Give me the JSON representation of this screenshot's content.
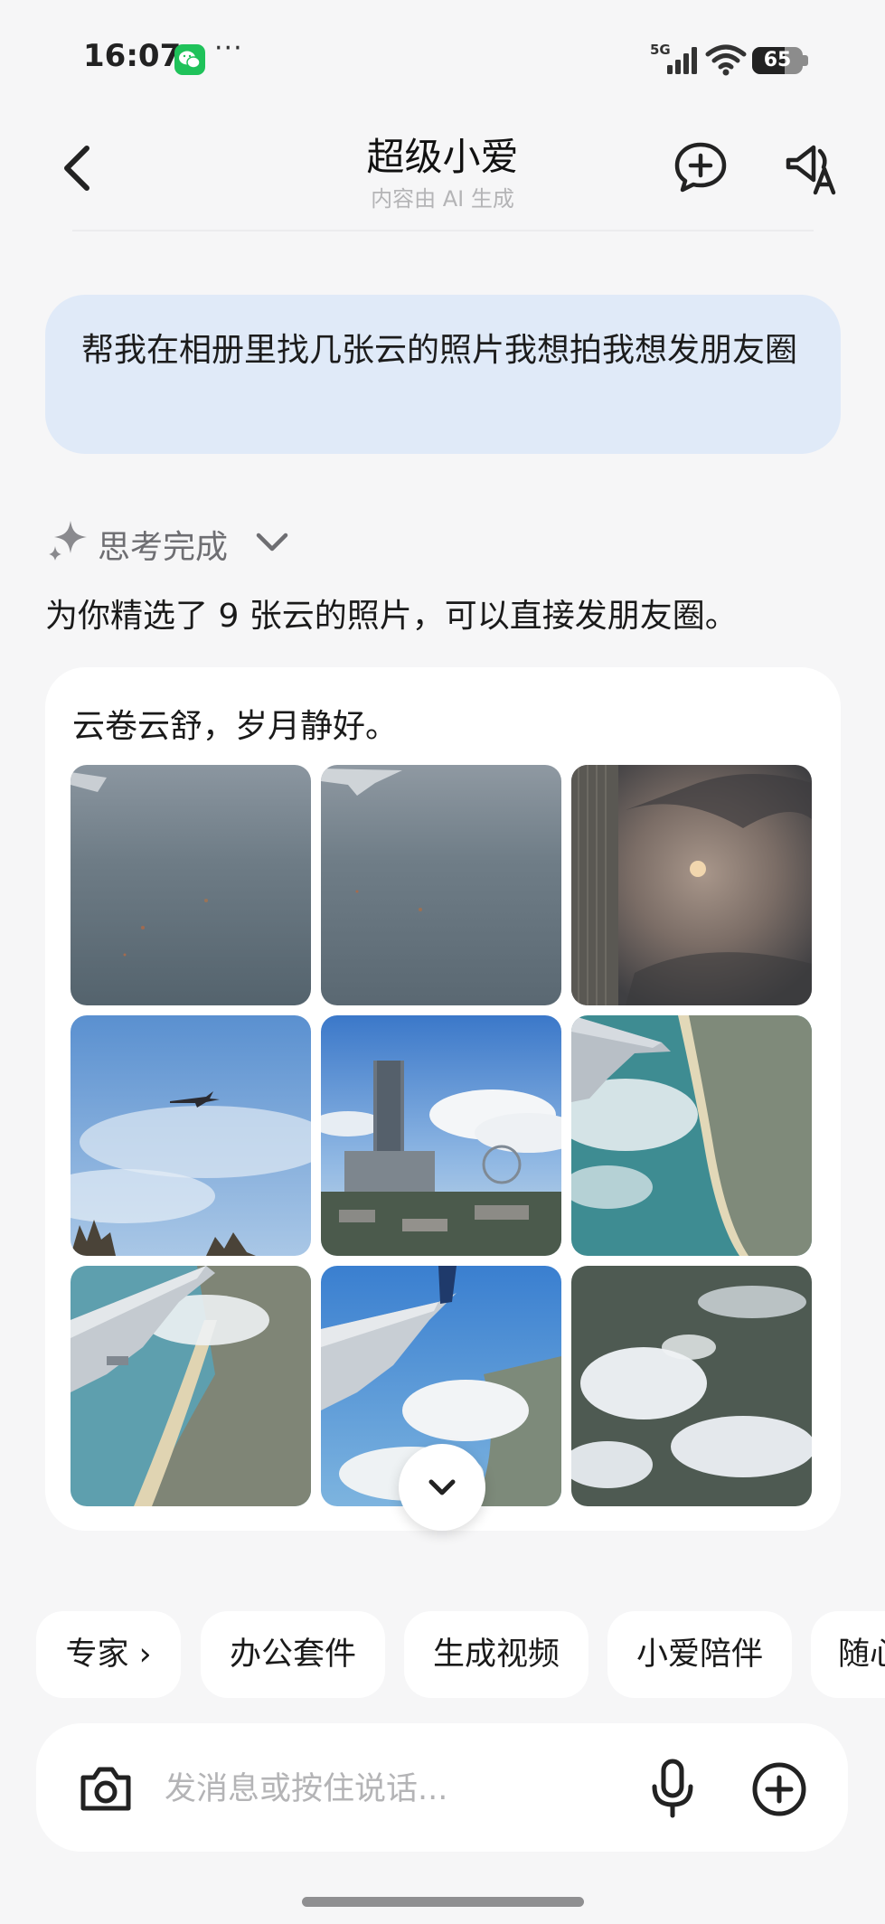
{
  "status_bar": {
    "time": "16:07",
    "dots": "···",
    "network": "5G",
    "battery": "65",
    "battery_level": 0.65
  },
  "header": {
    "title": "超级小爱",
    "subtitle": "内容由 AI 生成"
  },
  "chat": {
    "user_message": "帮我在相册里找几张云的照片我想拍我想发朋友圈",
    "thinking_status": "思考完成",
    "reply": "为你精选了 9 张云的照片，可以直接发朋友圈。",
    "caption": "云卷云舒，岁月静好。",
    "photos": [
      "airplane-window-haze",
      "airplane-wing-haze",
      "moon-behind-clouds",
      "airplane-in-blue-sky",
      "tower-building-clouds",
      "wing-over-coastline",
      "wing-over-sea",
      "wing-over-beach",
      "clouds-over-land"
    ]
  },
  "chips": [
    "专家 ›",
    "办公套件",
    "生成视频",
    "小爱陪伴",
    "随心"
  ],
  "input": {
    "placeholder": "发消息或按住说话..."
  },
  "colors": {
    "accent_bubble": "#e0eaf8",
    "background": "#f6f6f7",
    "wechat_green": "#1fc25a"
  }
}
